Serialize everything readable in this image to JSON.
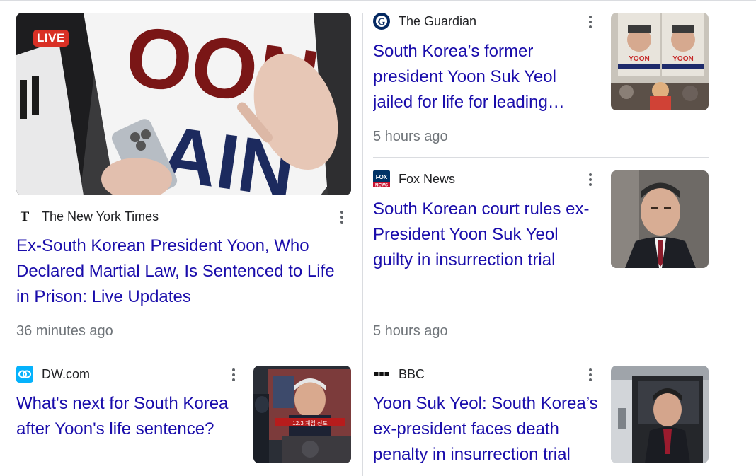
{
  "colors": {
    "headline": "#1a0dab",
    "source": "#202124",
    "timestamp": "#70757a",
    "live": "#d93025",
    "divider": "#dadce0"
  },
  "articles": [
    {
      "source": "The New York Times",
      "source_icon": "nyt-logo-icon",
      "headline": "Ex-South Korean President Yoon, Who Declared Martial Law, Is Sentenced to Life in Prison: Live Updates",
      "time": "36 minutes ago",
      "badge": "LIVE",
      "image": "protest-sign-yoon-again-photo"
    },
    {
      "source": "The Guardian",
      "source_icon": "guardian-logo-icon",
      "headline": "South Korea’s former president Yoon Suk Yeol jailed for life for leading…",
      "time": "5 hours ago",
      "image": "yoon-protest-posters-photo"
    },
    {
      "source": "Fox News",
      "source_icon": "fox-news-logo-icon",
      "headline": "South Korean court rules ex-President Yoon Suk Yeol guilty in insurrection trial",
      "time": "5 hours ago",
      "image": "yoon-portrait-photo"
    },
    {
      "source": "DW.com",
      "source_icon": "dw-logo-icon",
      "headline": "What's next for South Korea after Yoon's life sentence?",
      "image": "tv-broadcast-yoon-photo"
    },
    {
      "source": "BBC",
      "source_icon": "bbc-logo-icon",
      "headline": "Yoon Suk Yeol: South Korea’s ex-president faces death penalty in insurrection trial",
      "image": "yoon-in-vehicle-photo"
    }
  ]
}
